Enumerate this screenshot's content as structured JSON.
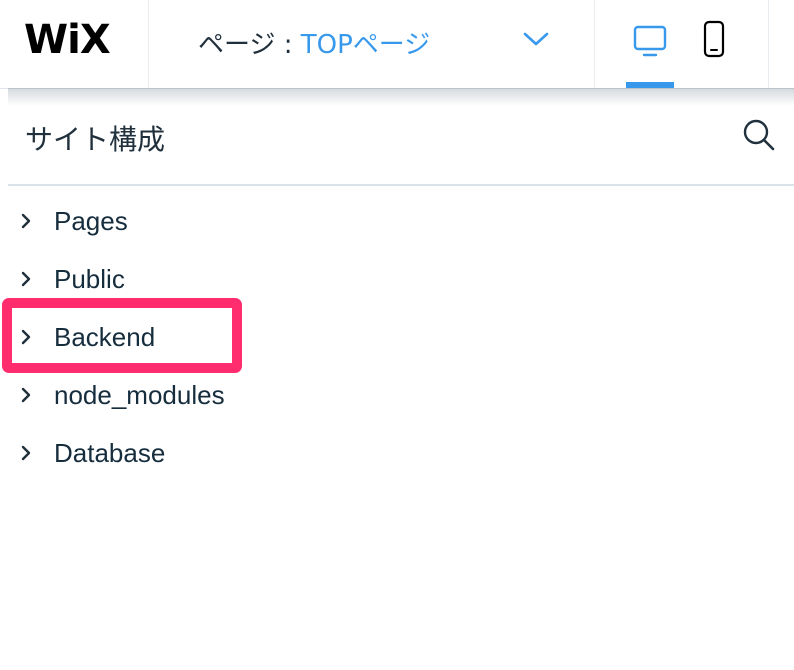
{
  "topbar": {
    "logo_text": "WiX",
    "page_prefix": "ページ : ",
    "page_name": "TOPページ",
    "devices": [
      {
        "name": "desktop",
        "icon": "desktop-icon",
        "active": true
      },
      {
        "name": "mobile",
        "icon": "mobile-icon",
        "active": false
      }
    ]
  },
  "panel": {
    "title": "サイト構成",
    "search_icon": "search-icon",
    "tree": [
      {
        "label": "Pages"
      },
      {
        "label": "Public"
      },
      {
        "label": "Backend",
        "highlighted": true
      },
      {
        "label": "node_modules"
      },
      {
        "label": "Database"
      }
    ]
  },
  "colors": {
    "accent": "#3899ec",
    "highlight": "#ff2d6d",
    "text": "#162d3d"
  }
}
